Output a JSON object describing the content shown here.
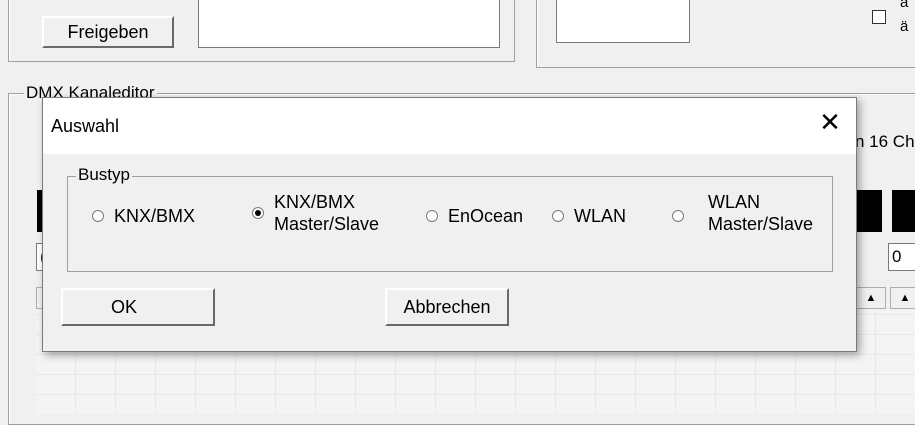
{
  "background": {
    "freigeben_label": "Freigeben",
    "checkbox_text_top": "a",
    "checkbox_text_bottom": "ä",
    "dmx_group_label": "DMX Kanaleditor",
    "channels_text": "n 16 Ch",
    "right_value_field": "0",
    "left_value_field": "("
  },
  "dialog": {
    "title": "Auswahl",
    "close_glyph": "✕",
    "group_label": "Bustyp",
    "options": [
      {
        "line1": "KNX/BMX",
        "line2": "",
        "checked": false
      },
      {
        "line1": "KNX/BMX",
        "line2": "Master/Slave",
        "checked": true
      },
      {
        "line1": "EnOcean",
        "line2": "",
        "checked": false
      },
      {
        "line1": "WLAN",
        "line2": "",
        "checked": false
      },
      {
        "line1": "WLAN",
        "line2": "Master/Slave",
        "checked": false
      }
    ],
    "ok_label": "OK",
    "cancel_label": "Abbrechen"
  }
}
